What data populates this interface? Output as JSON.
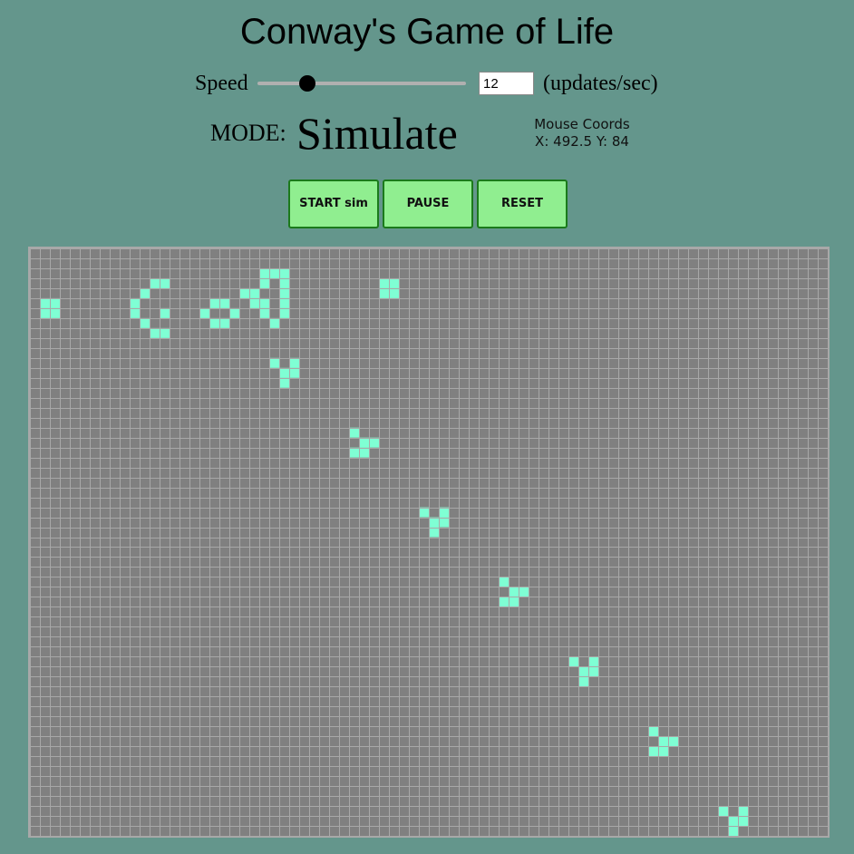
{
  "page": {
    "title": "Conway's Game of Life"
  },
  "controls": {
    "speed_label": "Speed",
    "speed_value": "12",
    "speed_slider_fraction": 0.24,
    "units_label": "(updates/sec)",
    "mode_label": "MODE:",
    "mode_value": "Simulate",
    "mouse_coords_label": "Mouse Coords",
    "mouse_coords_value": "X: 492.5 Y: 84"
  },
  "buttons": {
    "start": "START sim",
    "pause": "PAUSE",
    "reset": "RESET"
  },
  "colors": {
    "background": "#64968c",
    "grid_background": "#808080",
    "grid_lines": "#a8a8a8",
    "live_cell": "#7fffd4",
    "button_fill": "#90ee90",
    "button_border": "#1b7a1b"
  },
  "grid": {
    "cols": 80,
    "rows": 59,
    "live_cells": [
      [
        1,
        5
      ],
      [
        2,
        5
      ],
      [
        1,
        6
      ],
      [
        2,
        6
      ],
      [
        35,
        3
      ],
      [
        36,
        3
      ],
      [
        35,
        4
      ],
      [
        36,
        4
      ],
      [
        12,
        3
      ],
      [
        13,
        3
      ],
      [
        11,
        4
      ],
      [
        10,
        5
      ],
      [
        10,
        6
      ],
      [
        13,
        6
      ],
      [
        11,
        7
      ],
      [
        12,
        8
      ],
      [
        13,
        8
      ],
      [
        17,
        6
      ],
      [
        18,
        5
      ],
      [
        19,
        5
      ],
      [
        18,
        7
      ],
      [
        19,
        7
      ],
      [
        20,
        6
      ],
      [
        21,
        4
      ],
      [
        22,
        4
      ],
      [
        22,
        5
      ],
      [
        23,
        5
      ],
      [
        23,
        6
      ],
      [
        23,
        3
      ],
      [
        24,
        2
      ],
      [
        23,
        2
      ],
      [
        25,
        2
      ],
      [
        25,
        3
      ],
      [
        25,
        4
      ],
      [
        25,
        5
      ],
      [
        25,
        6
      ],
      [
        24,
        7
      ],
      [
        24,
        11
      ],
      [
        25,
        12
      ],
      [
        26,
        12
      ],
      [
        26,
        11
      ],
      [
        25,
        13
      ],
      [
        32,
        18
      ],
      [
        33,
        19
      ],
      [
        34,
        19
      ],
      [
        32,
        20
      ],
      [
        33,
        20
      ],
      [
        39,
        26
      ],
      [
        40,
        27
      ],
      [
        41,
        27
      ],
      [
        41,
        26
      ],
      [
        40,
        28
      ],
      [
        47,
        33
      ],
      [
        48,
        34
      ],
      [
        49,
        34
      ],
      [
        47,
        35
      ],
      [
        48,
        35
      ],
      [
        54,
        41
      ],
      [
        55,
        42
      ],
      [
        56,
        42
      ],
      [
        56,
        41
      ],
      [
        55,
        43
      ],
      [
        62,
        48
      ],
      [
        63,
        49
      ],
      [
        64,
        49
      ],
      [
        62,
        50
      ],
      [
        63,
        50
      ],
      [
        69,
        56
      ],
      [
        70,
        57
      ],
      [
        71,
        57
      ],
      [
        71,
        56
      ],
      [
        70,
        58
      ]
    ]
  }
}
